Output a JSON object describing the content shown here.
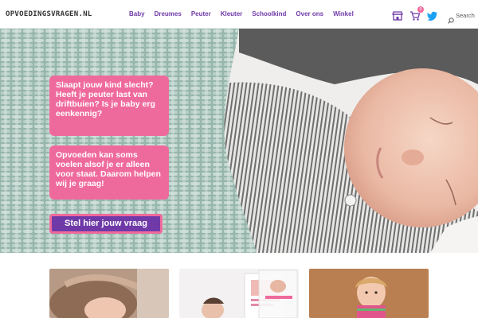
{
  "header": {
    "logo_text": "OPVOEDINGSVRAGEN.NL",
    "nav": [
      "Baby",
      "Dreumes",
      "Peuter",
      "Kleuter",
      "Schoolkind",
      "Over ons",
      "Winkel"
    ],
    "icons": [
      "store-icon",
      "cart-icon",
      "twitter-icon",
      "search-icon"
    ],
    "cart_count": "0",
    "search_label": "Search"
  },
  "hero": {
    "callout_1": "Slaapt jouw kind slecht? Heeft je peuter last van driftbuien? Is je baby erg eenkennig?",
    "callout_2": "Opvoeden kan soms voelen alsof je er alleen voor staat. Daarom helpen wij je graag!",
    "cta_label": "Stel hier jouw vraag"
  },
  "colors": {
    "accent_purple": "#6f3aa8",
    "accent_pink": "#ef6a9c"
  }
}
